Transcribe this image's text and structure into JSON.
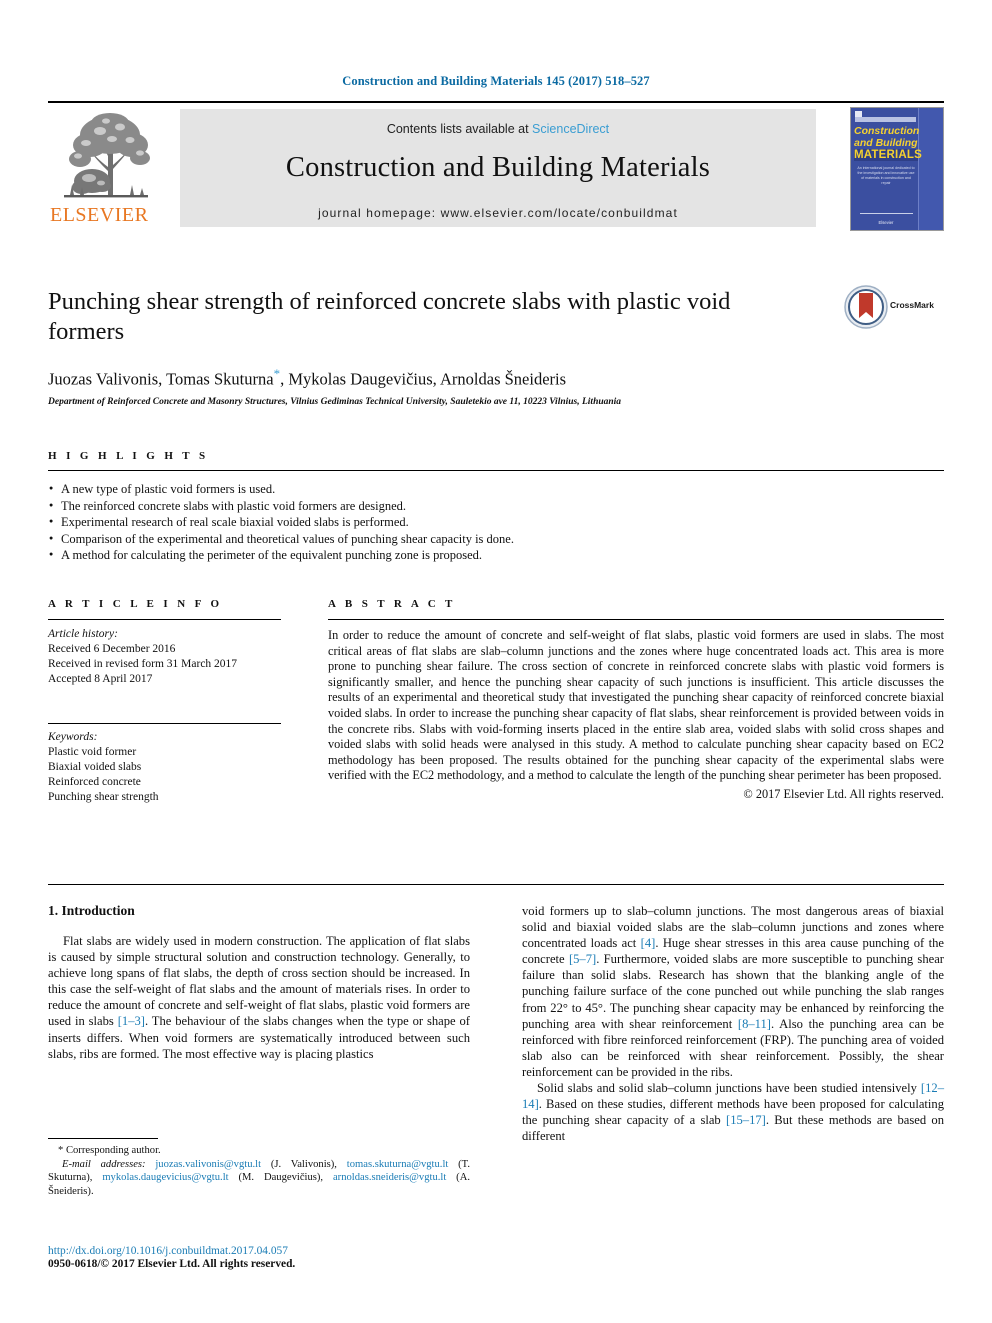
{
  "running_head": "Construction and Building Materials 145 (2017) 518–527",
  "masthead": {
    "publisher_name": "ELSEVIER",
    "contents_prefix": "Contents lists available at",
    "contents_link": "ScienceDirect",
    "journal_title": "Construction and Building Materials",
    "homepage": "journal homepage: www.elsevier.com/locate/conbuildmat",
    "cover": {
      "line1": "Construction",
      "line2": "and Building",
      "line3": "MATERIALS",
      "blurb": "An international journal dedicated to the investigation and innovative use of materials in construction and repair",
      "footer": "Elsevier"
    }
  },
  "article": {
    "title": "Punching shear strength of reinforced concrete slabs with plastic void formers",
    "authors_pre": "Juozas Valivonis, Tomas Skuturna",
    "corresponding_mark": "*",
    "authors_post": ", Mykolas Daugevičius, Arnoldas Šneideris",
    "affiliation": "Department of Reinforced Concrete and Masonry Structures, Vilnius Gediminas Technical University, Sauletekio ave 11, 10223 Vilnius, Lithuania",
    "crossmark_label": "CrossMark"
  },
  "highlights": {
    "heading": "H I G H L I G H T S",
    "items": [
      "A new type of plastic void formers is used.",
      "The reinforced concrete slabs with plastic void formers are designed.",
      "Experimental research of real scale biaxial voided slabs is performed.",
      "Comparison of the experimental and theoretical values of punching shear capacity is done.",
      "A method for calculating the perimeter of the equivalent punching zone is proposed."
    ]
  },
  "article_info": {
    "heading": "A R T I C L E   I N F O",
    "history_label": "Article history:",
    "history_lines": [
      "Received 6 December 2016",
      "Received in revised form 31 March 2017",
      "Accepted 8 April 2017"
    ],
    "keywords_label": "Keywords:",
    "keywords": [
      "Plastic void former",
      "Biaxial voided slabs",
      "Reinforced concrete",
      "Punching shear strength"
    ]
  },
  "abstract": {
    "heading": "A B S T R A C T",
    "text": "In order to reduce the amount of concrete and self-weight of flat slabs, plastic void formers are used in slabs. The most critical areas of flat slabs are slab–column junctions and the zones where huge concentrated loads act. This area is more prone to punching shear failure. The cross section of concrete in reinforced concrete slabs with plastic void formers is significantly smaller, and hence the punching shear capacity of such junctions is insufficient. This article discusses the results of an experimental and theoretical study that investigated the punching shear capacity of reinforced concrete biaxial voided slabs. In order to increase the punching shear capacity of flat slabs, shear reinforcement is provided between voids in the concrete ribs. Slabs with void-forming inserts placed in the entire slab area, voided slabs with solid cross shapes and voided slabs with solid heads were analysed in this study. A method to calculate punching shear capacity based on EC2 methodology has been proposed. The results obtained for the punching shear capacity of the experimental slabs were verified with the EC2 methodology, and a method to calculate the length of the punching shear perimeter has been proposed.",
    "copyright": "© 2017 Elsevier Ltd. All rights reserved."
  },
  "introduction": {
    "heading": "1. Introduction",
    "left_paragraphs": [
      {
        "parts": [
          {
            "t": "Flat slabs are widely used in modern construction. The application of flat slabs is caused by simple structural solution and construction technology. Generally, to achieve long spans of flat slabs, the depth of cross section should be increased. In this case the self-weight of flat slabs and the amount of materials rises. In order to reduce the amount of concrete and self-weight of flat slabs, plastic void formers are used in slabs ",
            "ref": false
          },
          {
            "t": "[1–3]",
            "ref": true
          },
          {
            "t": ". The behaviour of the slabs changes when the type or shape of inserts differs. When void formers are systematically introduced between such slabs, ribs are formed. The most effective way is placing plastics",
            "ref": false
          }
        ]
      }
    ],
    "right_paragraphs": [
      {
        "parts": [
          {
            "t": "void formers up to slab–column junctions. The most dangerous areas of biaxial solid and biaxial voided slabs are the slab–column junctions and zones where concentrated loads act ",
            "ref": false
          },
          {
            "t": "[4]",
            "ref": true
          },
          {
            "t": ". Huge shear stresses in this area cause punching of the concrete ",
            "ref": false
          },
          {
            "t": "[5–7]",
            "ref": true
          },
          {
            "t": ". Furthermore, voided slabs are more susceptible to punching shear failure than solid slabs. Research has shown that the blanking angle of the punching failure surface of the cone punched out while punching the slab ranges from 22° to 45°. The punching shear capacity may be enhanced by reinforcing the punching area with shear reinforcement ",
            "ref": false
          },
          {
            "t": "[8–11]",
            "ref": true
          },
          {
            "t": ". Also the punching area can be reinforced with fibre reinforced reinforcement (FRP). The punching area of voided slab also can be reinforced with shear reinforcement. Possibly, the shear reinforcement can be provided in the ribs.",
            "ref": false
          }
        ]
      },
      {
        "parts": [
          {
            "t": "Solid slabs and solid slab–column junctions have been studied intensively ",
            "ref": false
          },
          {
            "t": "[12–14]",
            "ref": true
          },
          {
            "t": ". Based on these studies, different methods have been proposed for calculating the punching shear capacity of a slab ",
            "ref": false
          },
          {
            "t": "[15–17]",
            "ref": true
          },
          {
            "t": ". But these methods are based on different",
            "ref": false
          }
        ]
      }
    ]
  },
  "footnotes": {
    "corresponding": "* Corresponding author.",
    "email_label": "E-mail addresses:",
    "emails": [
      {
        "address": "juozas.valivonis@vgtu.lt",
        "person": "(J. Valivonis)"
      },
      {
        "address": "tomas.skuturna@vgtu.lt",
        "person": "(T. Skuturna)"
      },
      {
        "address": "mykolas.daugevicius@vgtu.lt",
        "person": "(M. Daugevičius)"
      },
      {
        "address": "arnoldas.sneideris@vgtu.lt",
        "person": "(A. Šneideris)"
      }
    ],
    "doi": "http://dx.doi.org/10.1016/j.conbuildmat.2017.04.057",
    "issn_line": "0950-0618/© 2017 Elsevier Ltd. All rights reserved."
  },
  "colors": {
    "link": "#1a7cb5",
    "running_head": "#0b6aa2",
    "sciencedirect": "#3a9dd2",
    "elsevier_orange": "#e87722",
    "cover_blue": "#3b4fa0",
    "cover_yellow": "#f5d130",
    "band_grey": "#e4e4e4"
  }
}
